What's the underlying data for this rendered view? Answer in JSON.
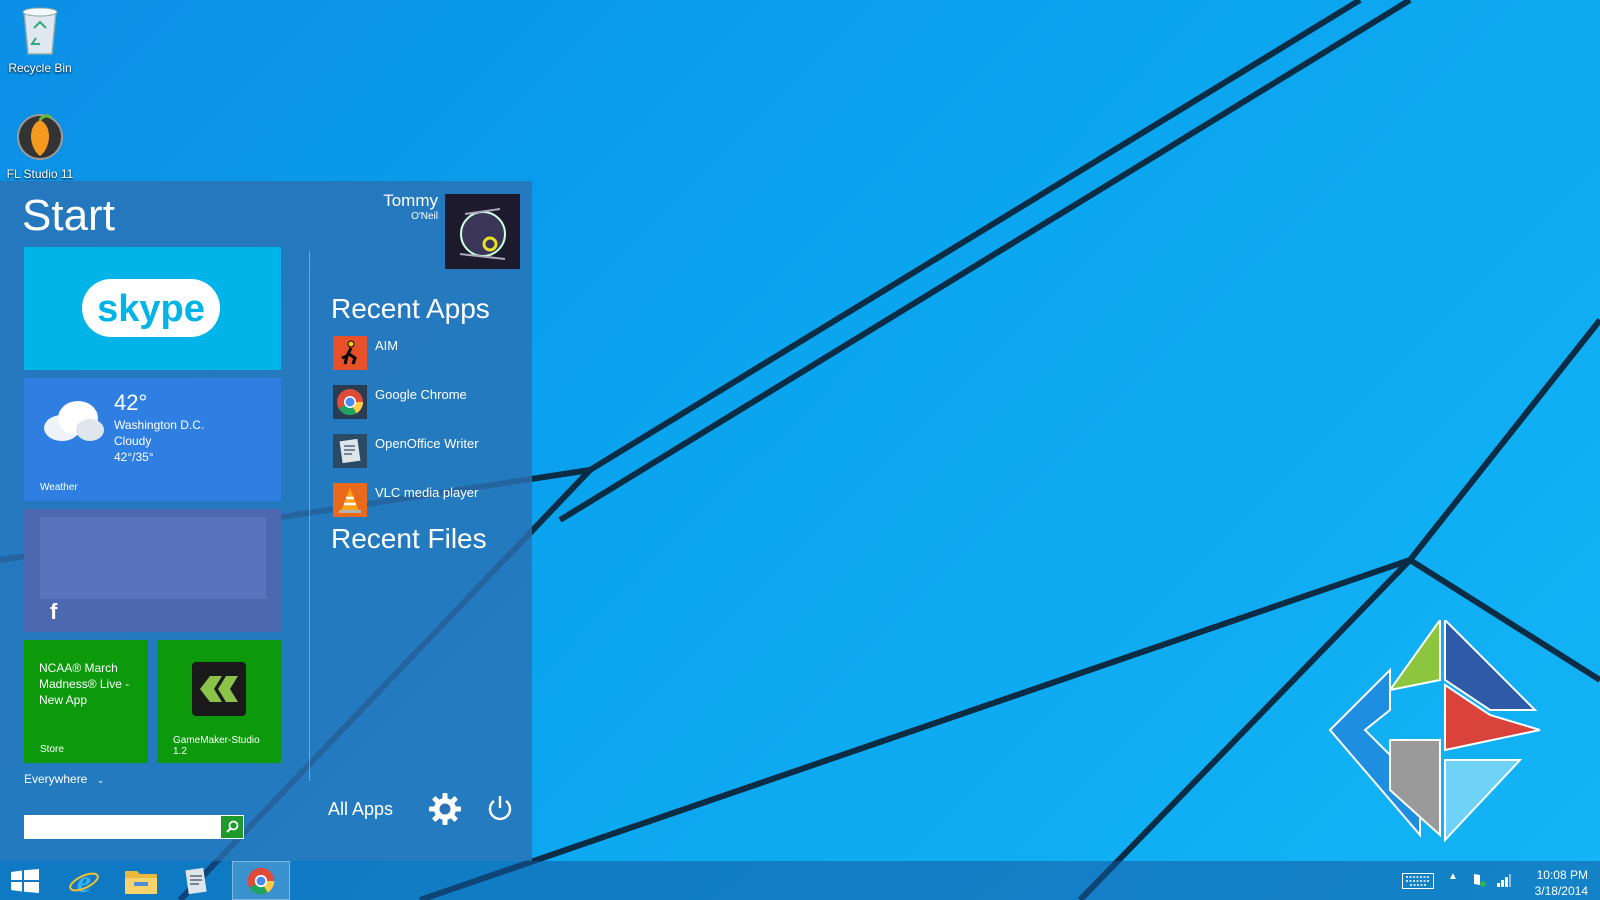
{
  "desktop": {
    "icons": [
      {
        "label": "Recycle Bin"
      },
      {
        "label": "FL Studio 11"
      }
    ]
  },
  "start": {
    "title": "Start",
    "user": {
      "first": "Tommy",
      "last": "O'Neil"
    },
    "tiles": {
      "skype": {
        "label": "skype"
      },
      "weather": {
        "temp": "42°",
        "city": "Washington D.C.",
        "condition": "Cloudy",
        "range": "42°/35°",
        "label": "Weather"
      },
      "store": {
        "title": "NCAA® March Madness® Live - New App",
        "label": "Store"
      },
      "gamemaker": {
        "label": "GameMaker-Studio 1.2"
      }
    },
    "recent_apps_heading": "Recent Apps",
    "recent_apps": [
      {
        "name": "AIM",
        "icon": "aim-icon"
      },
      {
        "name": "Google Chrome",
        "icon": "chrome-icon"
      },
      {
        "name": "OpenOffice Writer",
        "icon": "openoffice-writer-icon"
      },
      {
        "name": "VLC media player",
        "icon": "vlc-icon"
      }
    ],
    "recent_files_heading": "Recent Files",
    "search_scope": "Everywhere",
    "search_placeholder": "",
    "all_apps_label": "All Apps"
  },
  "taskbar": {
    "time": "10:08 PM",
    "date": "3/18/2014"
  },
  "colors": {
    "start_bg": "#2b71b4",
    "skype_tile": "#00b4e8",
    "weather_tile": "#2f7fe3",
    "facebook_tile": "#4c68b0",
    "store_tile": "#0c9a0c",
    "gamemaker_tile": "#0c9a0c"
  }
}
